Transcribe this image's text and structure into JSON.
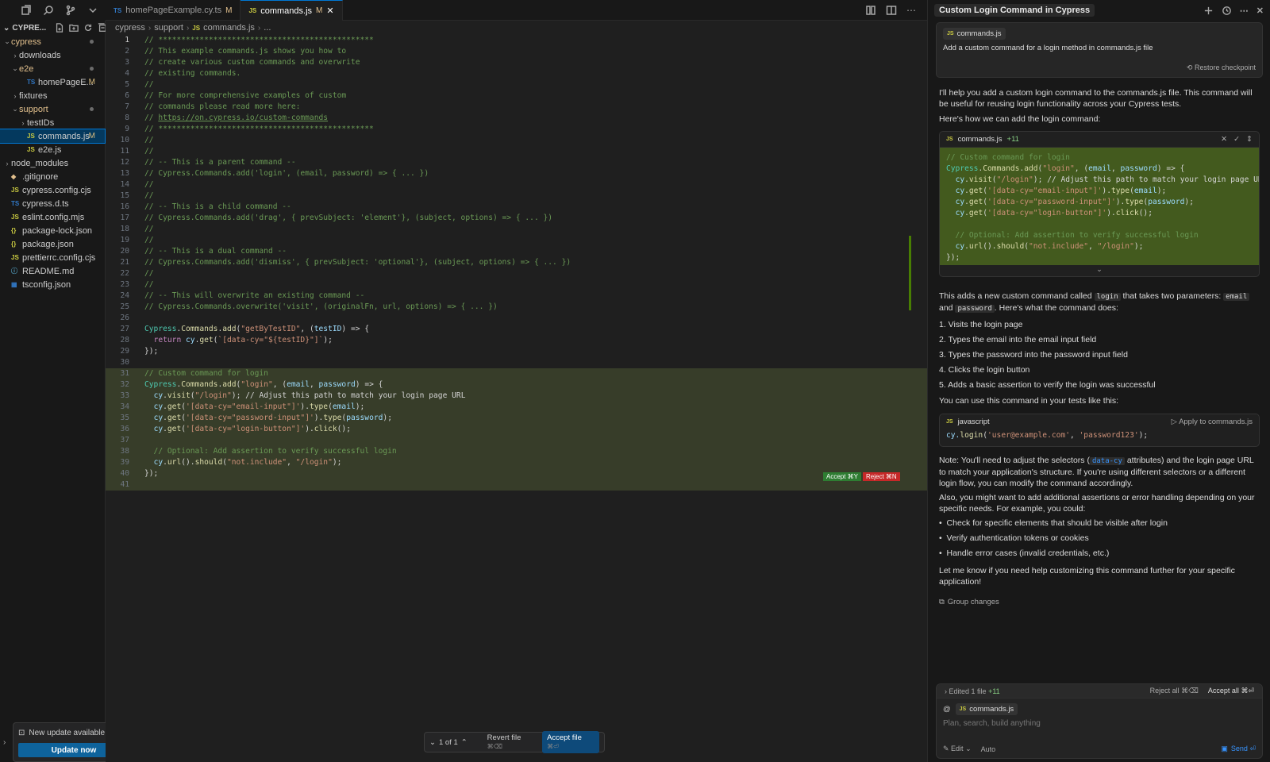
{
  "sidebar": {
    "title": "CYPRE...",
    "items": [
      {
        "label": "cypress",
        "type": "folder",
        "open": true,
        "depth": 0
      },
      {
        "label": "downloads",
        "type": "folder",
        "open": false,
        "depth": 1
      },
      {
        "label": "e2e",
        "type": "folder",
        "open": true,
        "depth": 1
      },
      {
        "label": "homePageE...",
        "type": "ts",
        "depth": 2,
        "badge": "M"
      },
      {
        "label": "fixtures",
        "type": "folder",
        "open": false,
        "depth": 1
      },
      {
        "label": "support",
        "type": "folder",
        "open": true,
        "depth": 1
      },
      {
        "label": "testIDs",
        "type": "folder",
        "open": false,
        "depth": 2
      },
      {
        "label": "commands.js",
        "type": "js",
        "depth": 2,
        "badge": "M",
        "selected": true
      },
      {
        "label": "e2e.js",
        "type": "js",
        "depth": 2
      },
      {
        "label": "node_modules",
        "type": "folder",
        "open": false,
        "depth": 0
      },
      {
        "label": ".gitignore",
        "type": "git",
        "depth": 0
      },
      {
        "label": "cypress.config.cjs",
        "type": "js",
        "depth": 0
      },
      {
        "label": "cypress.d.ts",
        "type": "ts",
        "depth": 0
      },
      {
        "label": "eslint.config.mjs",
        "type": "js",
        "depth": 0
      },
      {
        "label": "package-lock.json",
        "type": "json",
        "depth": 0
      },
      {
        "label": "package.json",
        "type": "json",
        "depth": 0
      },
      {
        "label": "prettierrc.config.cjs",
        "type": "js",
        "depth": 0
      },
      {
        "label": "README.md",
        "type": "info",
        "depth": 0
      },
      {
        "label": "tsconfig.json",
        "type": "tsconfig",
        "depth": 0
      }
    ]
  },
  "update": {
    "text": "New update available",
    "button": "Update now"
  },
  "tabs": [
    {
      "lang": "TS",
      "label": "homePageExample.cy.ts",
      "modified": "M"
    },
    {
      "lang": "JS",
      "label": "commands.js",
      "modified": "M"
    }
  ],
  "breadcrumb": {
    "a": "cypress",
    "b": "support",
    "c": "commands.js",
    "d": "..."
  },
  "editor": {
    "lines": [
      {
        "n": "1",
        "t": "// ***********************************************",
        "k": "cm"
      },
      {
        "n": "2",
        "t": "// This example commands.js shows you how to",
        "k": "cm"
      },
      {
        "n": "3",
        "t": "// create various custom commands and overwrite",
        "k": "cm"
      },
      {
        "n": "4",
        "t": "// existing commands.",
        "k": "cm"
      },
      {
        "n": "5",
        "t": "//",
        "k": "cm"
      },
      {
        "n": "6",
        "t": "// For more comprehensive examples of custom",
        "k": "cm"
      },
      {
        "n": "7",
        "t": "// commands please read more here:",
        "k": "cm"
      },
      {
        "n": "8",
        "t": "// ",
        "k": "cm",
        "link": "https://on.cypress.io/custom-commands"
      },
      {
        "n": "9",
        "t": "// ***********************************************",
        "k": "cm"
      },
      {
        "n": "10",
        "t": "//",
        "k": "cm"
      },
      {
        "n": "11",
        "t": "//",
        "k": "cm"
      },
      {
        "n": "12",
        "t": "// -- This is a parent command --",
        "k": "cm"
      },
      {
        "n": "13",
        "t": "// Cypress.Commands.add('login', (email, password) => { ... })",
        "k": "cm"
      },
      {
        "n": "14",
        "t": "//",
        "k": "cm"
      },
      {
        "n": "15",
        "t": "//",
        "k": "cm"
      },
      {
        "n": "16",
        "t": "// -- This is a child command --",
        "k": "cm"
      },
      {
        "n": "17",
        "t": "// Cypress.Commands.add('drag', { prevSubject: 'element'}, (subject, options) => { ... })",
        "k": "cm"
      },
      {
        "n": "18",
        "t": "//",
        "k": "cm"
      },
      {
        "n": "19",
        "t": "//",
        "k": "cm"
      },
      {
        "n": "20",
        "t": "// -- This is a dual command --",
        "k": "cm"
      },
      {
        "n": "21",
        "t": "// Cypress.Commands.add('dismiss', { prevSubject: 'optional'}, (subject, options) => { ... })",
        "k": "cm"
      },
      {
        "n": "22",
        "t": "//",
        "k": "cm"
      },
      {
        "n": "23",
        "t": "//",
        "k": "cm"
      },
      {
        "n": "24",
        "t": "// -- This will overwrite an existing command --",
        "k": "cm"
      },
      {
        "n": "25",
        "t": "// Cypress.Commands.overwrite('visit', (originalFn, url, options) => { ... })",
        "k": "cm"
      },
      {
        "n": "26",
        "t": "",
        "k": "pl"
      },
      {
        "n": "27",
        "t": "Cypress.Commands.add(\"getByTestID\", (testID) => {",
        "k": "code"
      },
      {
        "n": "28",
        "t": "  return cy.get(`[data-cy=\"${testID}\"]`);",
        "k": "code"
      },
      {
        "n": "29",
        "t": "});",
        "k": "code"
      },
      {
        "n": "30",
        "t": "",
        "k": "pl"
      },
      {
        "n": "31",
        "t": "// Custom command for login",
        "k": "cm",
        "added": true
      },
      {
        "n": "32",
        "t": "Cypress.Commands.add(\"login\", (email, password) => {",
        "k": "code",
        "added": true
      },
      {
        "n": "33",
        "t": "  cy.visit(\"/login\"); // Adjust this path to match your login page URL",
        "k": "code",
        "added": true
      },
      {
        "n": "34",
        "t": "  cy.get('[data-cy=\"email-input\"]').type(email);",
        "k": "code",
        "added": true
      },
      {
        "n": "35",
        "t": "  cy.get('[data-cy=\"password-input\"]').type(password);",
        "k": "code",
        "added": true
      },
      {
        "n": "36",
        "t": "  cy.get('[data-cy=\"login-button\"]').click();",
        "k": "code",
        "added": true
      },
      {
        "n": "37",
        "t": "",
        "k": "pl",
        "added": true
      },
      {
        "n": "38",
        "t": "  // Optional: Add assertion to verify successful login",
        "k": "cm",
        "added": true
      },
      {
        "n": "39",
        "t": "  cy.url().should(\"not.include\", \"/login\");",
        "k": "code",
        "added": true
      },
      {
        "n": "40",
        "t": "});",
        "k": "code",
        "added": true
      },
      {
        "n": "41",
        "t": "",
        "k": "pl",
        "added": true
      }
    ],
    "accept_label": "Accept ⌘Y",
    "reject_label": "Reject ⌘N"
  },
  "review": {
    "pager": "1 of 1",
    "revert": "Revert file",
    "revert_key": "⌘⌫",
    "accept": "Accept file",
    "accept_key": "⌘⏎"
  },
  "panel": {
    "title": "Custom Login Command in Cypress",
    "user_chip": "commands.js",
    "user_message": "Add a custom command for a login method in commands.js file",
    "restore": "Restore checkpoint",
    "p1": "I'll help you add a custom login command to the commands.js file. This command will be useful for reusing login functionality across your Cypress tests.",
    "p2": "Here's how we can add the login command:",
    "diff_file": "commands.js",
    "diff_count": "+11",
    "diff_lines": [
      {
        "t": "// Custom command for login",
        "k": "cm"
      },
      {
        "t": "Cypress.Commands.add(\"login\", (email, password) => {",
        "k": "code"
      },
      {
        "t": "  cy.visit(\"/login\"); // Adjust this path to match your login page URL",
        "k": "code"
      },
      {
        "t": "  cy.get('[data-cy=\"email-input\"]').type(email);",
        "k": "code"
      },
      {
        "t": "  cy.get('[data-cy=\"password-input\"]').type(password);",
        "k": "code"
      },
      {
        "t": "  cy.get('[data-cy=\"login-button\"]').click();",
        "k": "code"
      },
      {
        "t": "",
        "k": "pl"
      },
      {
        "t": "  // Optional: Add assertion to verify successful login",
        "k": "cm"
      },
      {
        "t": "  cy.url().should(\"not.include\", \"/login\");",
        "k": "code"
      },
      {
        "t": "});",
        "k": "code"
      }
    ],
    "p3a": "This adds a new custom command called ",
    "p3code1": "login",
    "p3b": " that takes two parameters: ",
    "p3code2": "email",
    "p3c": " and ",
    "p3code3": "password",
    "p3d": ". Here's what the command does:",
    "steps": [
      "1. Visits the login page",
      "2. Types the email into the email input field",
      "3. Types the password into the password input field",
      "4. Clicks the login button",
      "5. Adds a basic assertion to verify the login was successful"
    ],
    "p4": "You can use this command in your tests like this:",
    "js_label": "javascript",
    "js_apply": "Apply to commands.js",
    "js_code": {
      "a": "cy.",
      "b": "login",
      "c": "(",
      "d": "'user@example.com'",
      "e": ", ",
      "f": "'password123'",
      "g": ");"
    },
    "p5a": "Note: You'll need to adjust the selectors (",
    "p5code": "data-cy",
    "p5b": " attributes) and the login page URL to match your application's structure. If you're using different selectors or a different login flow, you can modify the command accordingly.",
    "p6": "Also, you might want to add additional assertions or error handling depending on your specific needs. For example, you could:",
    "bullets": [
      "Check for specific elements that should be visible after login",
      "Verify authentication tokens or cookies",
      "Handle error cases (invalid credentials, etc.)"
    ],
    "p7": "Let me know if you need help customizing this command further for your specific application!",
    "group": "Group changes",
    "composer": {
      "edited": "Edited 1 file",
      "edited_count": "+11",
      "reject_all": "Reject all",
      "reject_key": "⌘⌫",
      "accept_all": "Accept all",
      "accept_key": "⌘⏎",
      "chip": "commands.js",
      "placeholder": "Plan, search, build anything",
      "mode": "Edit",
      "model": "Auto",
      "send": "Send"
    }
  }
}
